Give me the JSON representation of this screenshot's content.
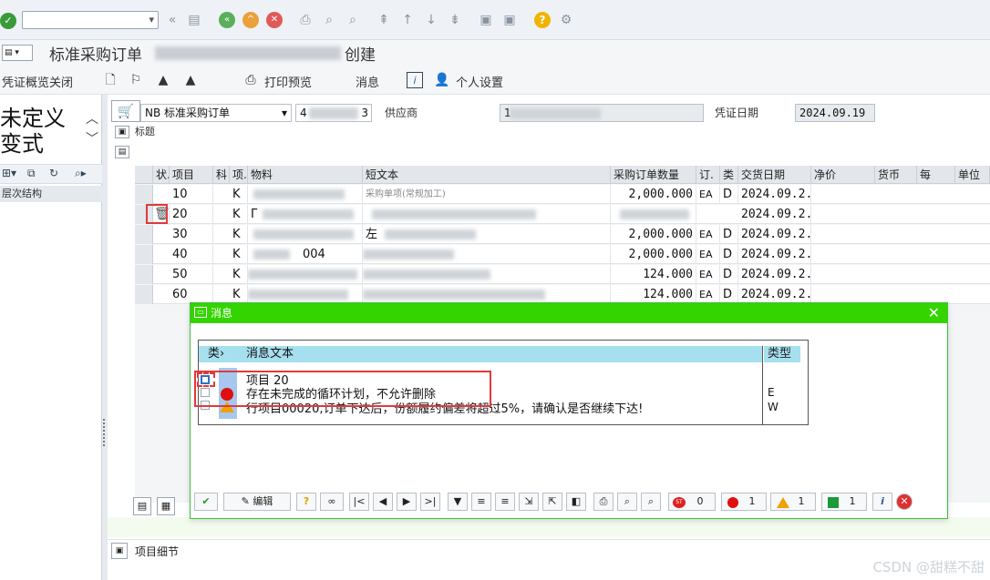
{
  "window": {
    "title_prefix": "标准采购订单",
    "title_suffix": "创建"
  },
  "app_toolbar": {
    "items": [
      "凭证概览关闭",
      "打印预览",
      "消息",
      "个人设置"
    ]
  },
  "left_panel": {
    "variant_label": "未定义变式",
    "tree_header": "层次结构"
  },
  "header": {
    "doc_type": "NB 标准采购订单",
    "po_number": "4",
    "po_number_tail": "3",
    "vendor_label": "供应商",
    "vendor_value": "1",
    "doc_date_label": "凭证日期",
    "doc_date_value": "2024.09.19",
    "section_label": "标题"
  },
  "item_table": {
    "columns": [
      "状.",
      "项目",
      "科",
      "项.",
      "物料",
      "短文本",
      "采购订单数量",
      "订.",
      "类",
      "交货日期",
      "净价",
      "货币",
      "每",
      "单位"
    ],
    "rows": [
      {
        "item": "10",
        "acc": "K",
        "qty": "2,000.000",
        "uom": "EA",
        "cat": "D",
        "date": "2024.09.2."
      },
      {
        "item": "20",
        "acc": "K",
        "qty": "",
        "uom": "",
        "cat": "",
        "date": "2024.09.2."
      },
      {
        "item": "30",
        "acc": "K",
        "qty": "2,000.000",
        "uom": "EA",
        "cat": "D",
        "date": "2024.09.2."
      },
      {
        "item": "40",
        "acc": "K",
        "qty": "2,000.000",
        "uom": "EA",
        "cat": "D",
        "date": "2024.09.2."
      },
      {
        "item": "50",
        "acc": "K",
        "qty": "124.000",
        "uom": "EA",
        "cat": "D",
        "date": "2024.09.2."
      },
      {
        "item": "60",
        "acc": "K",
        "qty": "124.000",
        "uom": "EA",
        "cat": "D",
        "date": "2024.09.2."
      }
    ],
    "row2_material_prefix": "Γ",
    "row3_shorttext": "左",
    "row4_material": "004",
    "row1_shorttext": "采购单项(常规加工)"
  },
  "item_detail_label": "项目细节",
  "dialog": {
    "title": "消息",
    "col_type_short": "类",
    "col_text": "消息文本",
    "col_type": "类型",
    "messages": [
      {
        "text": "项目 20",
        "type": ""
      },
      {
        "text": "存在未完成的循环计划，不允许删除",
        "type": "E"
      },
      {
        "text": "行项目00020,订单下达后，份额履约偏差将超过5%，请确认是否继续下达!",
        "type": "W"
      }
    ],
    "toolbar": {
      "edit_label": "编辑",
      "stop_count": "0",
      "error_count": "1",
      "warning_count": "1",
      "success_count": "1"
    }
  },
  "watermark": "CSDN @甜糕不甜",
  "colors": {
    "dialog_title": "#34d400",
    "header_blue": "#a6e0ee",
    "highlight_red": "#e03a3a"
  }
}
